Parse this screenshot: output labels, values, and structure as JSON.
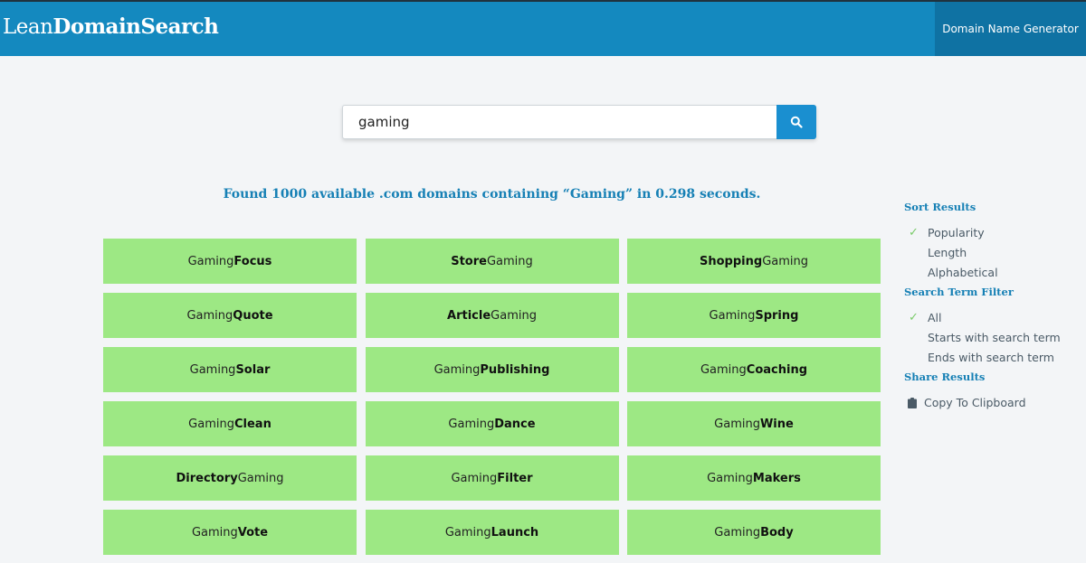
{
  "header": {
    "logo_light": "Lean",
    "logo_bold": "DomainSearch",
    "nav_generator": "Domain Name Generator"
  },
  "search": {
    "value": "gaming",
    "button_icon": "search-icon"
  },
  "results_summary": "Found 1000 available .com domains containing “Gaming” in 0.298 seconds.",
  "domains": [
    {
      "pre": "Gaming",
      "bold": "Focus",
      "post": ""
    },
    {
      "pre": "",
      "bold": "Store",
      "post": "Gaming"
    },
    {
      "pre": "",
      "bold": "Shopping",
      "post": "Gaming"
    },
    {
      "pre": "Gaming",
      "bold": "Quote",
      "post": ""
    },
    {
      "pre": "",
      "bold": "Article",
      "post": "Gaming"
    },
    {
      "pre": "Gaming",
      "bold": "Spring",
      "post": ""
    },
    {
      "pre": "Gaming",
      "bold": "Solar",
      "post": ""
    },
    {
      "pre": "Gaming",
      "bold": "Publishing",
      "post": ""
    },
    {
      "pre": "Gaming",
      "bold": "Coaching",
      "post": ""
    },
    {
      "pre": "Gaming",
      "bold": "Clean",
      "post": ""
    },
    {
      "pre": "Gaming",
      "bold": "Dance",
      "post": ""
    },
    {
      "pre": "Gaming",
      "bold": "Wine",
      "post": ""
    },
    {
      "pre": "",
      "bold": "Directory",
      "post": "Gaming"
    },
    {
      "pre": "Gaming",
      "bold": "Filter",
      "post": ""
    },
    {
      "pre": "Gaming",
      "bold": "Makers",
      "post": ""
    },
    {
      "pre": "Gaming",
      "bold": "Vote",
      "post": ""
    },
    {
      "pre": "Gaming",
      "bold": "Launch",
      "post": ""
    },
    {
      "pre": "Gaming",
      "bold": "Body",
      "post": ""
    }
  ],
  "sidebar": {
    "sort_title": "Sort Results",
    "sort_options": [
      {
        "label": "Popularity",
        "selected": true
      },
      {
        "label": "Length",
        "selected": false
      },
      {
        "label": "Alphabetical",
        "selected": false
      }
    ],
    "filter_title": "Search Term Filter",
    "filter_options": [
      {
        "label": "All",
        "selected": true
      },
      {
        "label": "Starts with search term",
        "selected": false
      },
      {
        "label": "Ends with search term",
        "selected": false
      }
    ],
    "share_title": "Share Results",
    "copy_label": "Copy To Clipboard"
  },
  "colors": {
    "header": "#1489bf",
    "accent": "#1680b5",
    "tile": "#9de884",
    "check": "#7acb6a"
  }
}
